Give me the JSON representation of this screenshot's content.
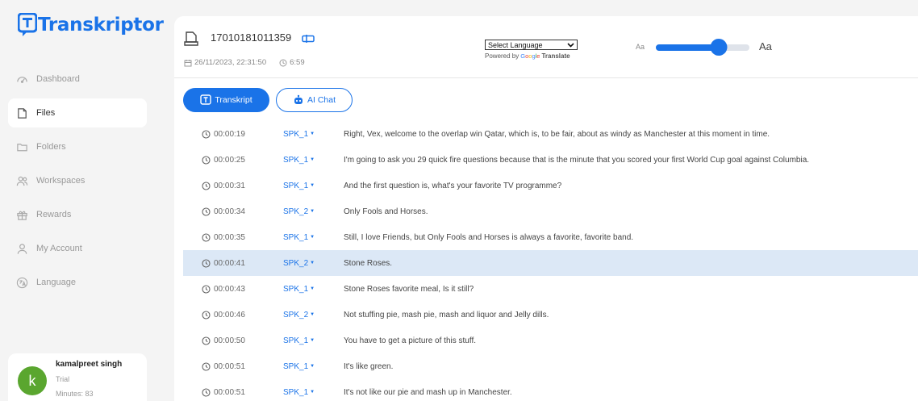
{
  "app": {
    "logo_text": "Transkriptor"
  },
  "sidebar": {
    "items": [
      {
        "label": "Dashboard",
        "icon": "dashboard-icon",
        "active": false
      },
      {
        "label": "Files",
        "icon": "file-icon",
        "active": true
      },
      {
        "label": "Folders",
        "icon": "folder-icon",
        "active": false
      },
      {
        "label": "Workspaces",
        "icon": "users-icon",
        "active": false
      },
      {
        "label": "Rewards",
        "icon": "gift-icon",
        "active": false
      },
      {
        "label": "My Account",
        "icon": "user-icon",
        "active": false
      },
      {
        "label": "Language",
        "icon": "language-icon",
        "active": false
      }
    ]
  },
  "user": {
    "initial": "k",
    "name": "kamalpreet singh",
    "plan": "Trial",
    "minutes": "Minutes: 83"
  },
  "header": {
    "file_title": "17010181011359",
    "date": "26/11/2023, 22:31:50",
    "duration": "6:59",
    "language_select": "Select Language",
    "powered_by": "Powered by",
    "google": "Google",
    "translate": "Translate",
    "font_small": "Aa",
    "font_large": "Aa",
    "font_size_level": 0.67
  },
  "tabs": {
    "transcript": "Transkript",
    "ai_chat": "AI Chat"
  },
  "transcript": [
    {
      "time": "00:00:19",
      "speaker": "SPK_1",
      "text": "Right, Vex, welcome to the overlap win Qatar, which is, to be fair, about as windy as Manchester at this moment in time."
    },
    {
      "time": "00:00:25",
      "speaker": "SPK_1",
      "text": "I'm going to ask you 29 quick fire questions because that is the minute that you scored your first World Cup goal against Columbia."
    },
    {
      "time": "00:00:31",
      "speaker": "SPK_1",
      "text": "And the first question is, what's your favorite TV programme?"
    },
    {
      "time": "00:00:34",
      "speaker": "SPK_2",
      "text": "Only Fools and Horses."
    },
    {
      "time": "00:00:35",
      "speaker": "SPK_1",
      "text": "Still, I love Friends, but Only Fools and Horses is always a favorite, favorite band."
    },
    {
      "time": "00:00:41",
      "speaker": "SPK_2",
      "text": "Stone Roses."
    },
    {
      "time": "00:00:43",
      "speaker": "SPK_1",
      "text": "Stone Roses favorite meal, Is it still?"
    },
    {
      "time": "00:00:46",
      "speaker": "SPK_2",
      "text": "Not stuffing pie, mash pie, mash and liquor and Jelly dills."
    },
    {
      "time": "00:00:50",
      "speaker": "SPK_1",
      "text": "You have to get a picture of this stuff."
    },
    {
      "time": "00:00:51",
      "speaker": "SPK_1",
      "text": "It's like green."
    },
    {
      "time": "00:00:51",
      "speaker": "SPK_1",
      "text": "It's not like our pie and mash up in Manchester."
    }
  ],
  "colors": {
    "accent": "#1a73e8",
    "highlight_row": "#dce8f6",
    "avatar": "#5aa62f"
  }
}
